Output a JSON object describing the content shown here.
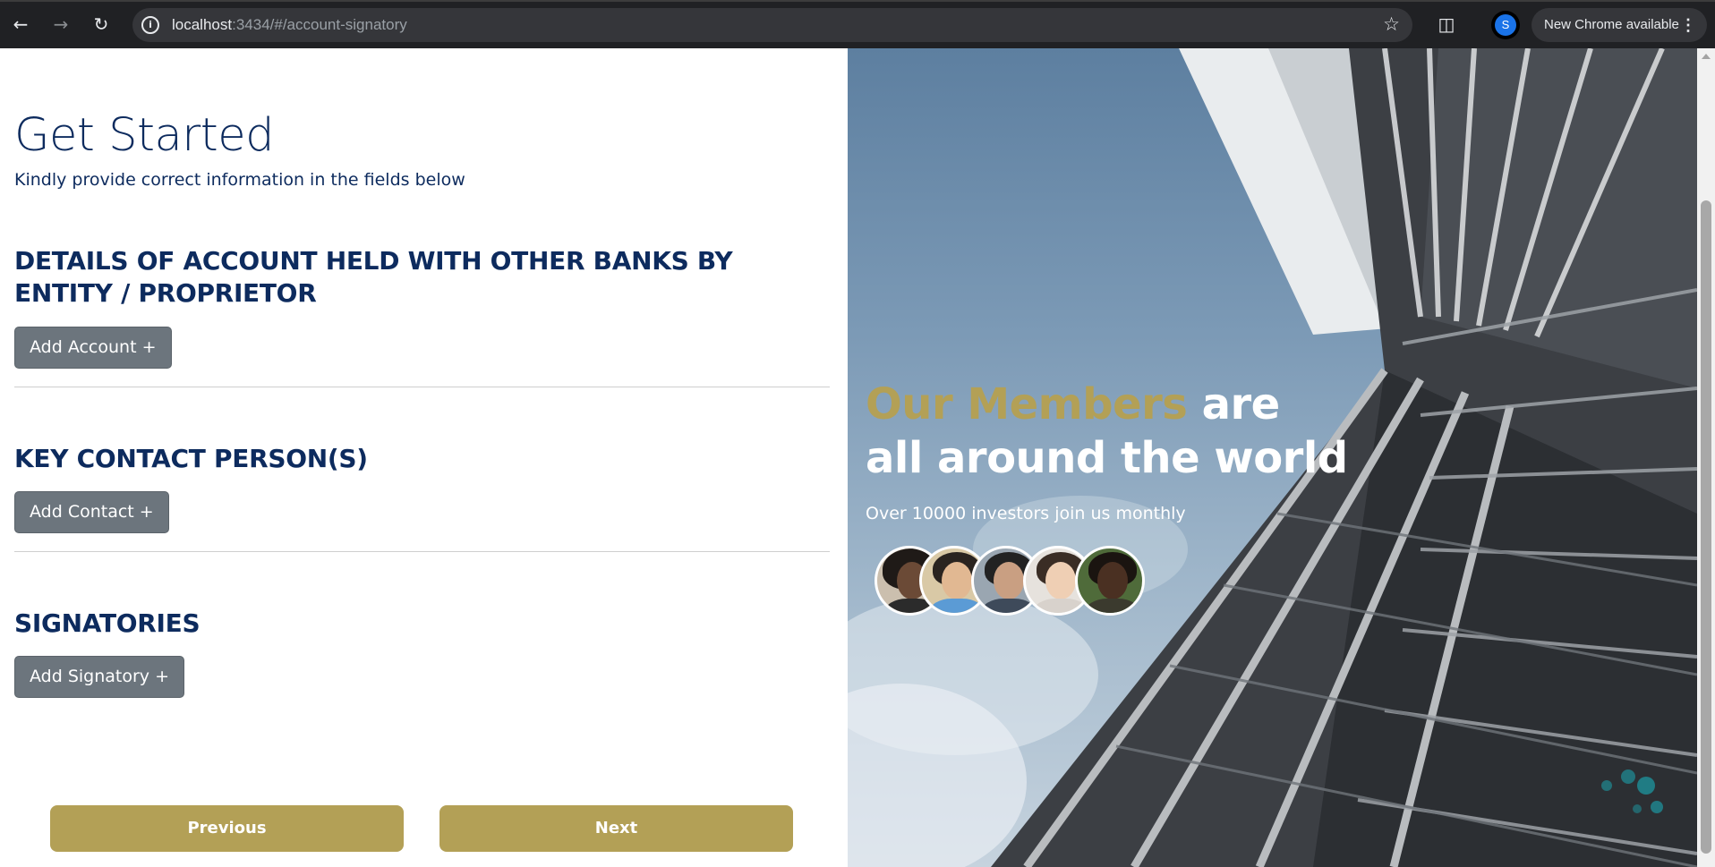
{
  "browser": {
    "url_host": "localhost",
    "url_path": ":3434/#/account-signatory",
    "profile_initial": "S",
    "update_label": "New Chrome available"
  },
  "form": {
    "title": "Get Started",
    "subtitle": "Kindly provide correct information in the fields below",
    "sections": [
      {
        "heading": "DETAILS OF ACCOUNT HELD WITH OTHER BANKS BY ENTITY / PROPRIETOR",
        "button": "Add Account +"
      },
      {
        "heading": "KEY CONTACT PERSON(S)",
        "button": "Add Contact +"
      },
      {
        "heading": "SIGNATORIES",
        "button": "Add Signatory +"
      }
    ],
    "previous_label": "Previous",
    "next_label": "Next"
  },
  "hero": {
    "title_highlight": "Our Members",
    "title_rest_line1": " are",
    "title_line2": "all around the world",
    "subtitle": "Over 10000 investors join us monthly",
    "avatar_count": 5
  },
  "colors": {
    "navy": "#0d2b5e",
    "gold": "#b3a056",
    "button_gray": "#6c757d"
  }
}
